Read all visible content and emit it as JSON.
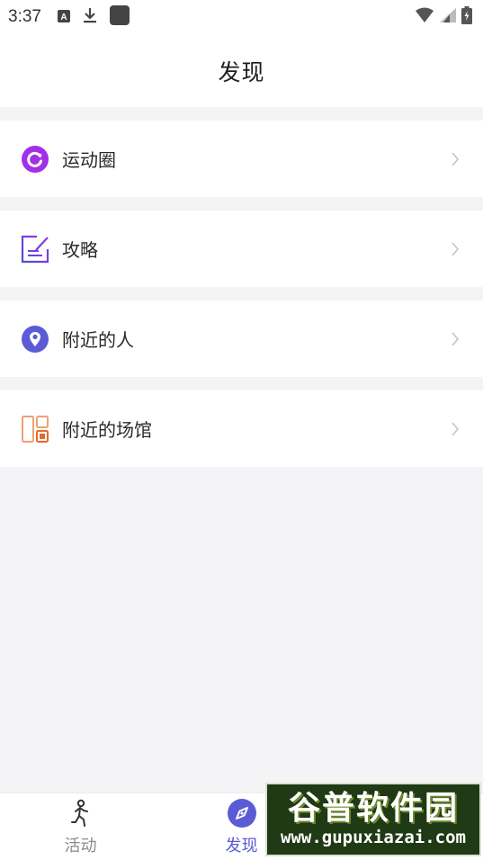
{
  "status_bar": {
    "time": "3:37",
    "left_icons": [
      "a-box-icon",
      "download-icon",
      "app-square-icon"
    ],
    "right_icons": [
      "wifi-icon",
      "signal-icon",
      "battery-charging-icon"
    ]
  },
  "header": {
    "title": "发现"
  },
  "menu": {
    "items": [
      {
        "label": "运动圈",
        "icon": "sport-circle-icon",
        "color": "#a230e6"
      },
      {
        "label": "攻略",
        "icon": "guide-edit-icon",
        "color": "#5b4fd6"
      },
      {
        "label": "附近的人",
        "icon": "location-pin-icon",
        "color": "#5b5bd6"
      },
      {
        "label": "附近的场馆",
        "icon": "venue-layout-icon",
        "color": "#e8793a"
      }
    ]
  },
  "tabbar": {
    "tabs": [
      {
        "label": "活动",
        "icon": "running-person-icon",
        "active": false
      },
      {
        "label": "发现",
        "icon": "compass-icon",
        "active": true,
        "color": "#5b5bd6"
      },
      {
        "label": "",
        "icon": "profile-icon",
        "active": false
      }
    ]
  },
  "watermark": {
    "logo_text": "谷普软件园",
    "url": "www.gupuxiazai.com"
  }
}
